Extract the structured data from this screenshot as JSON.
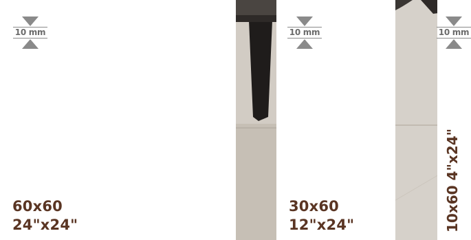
{
  "thickness_label": "10 mm",
  "formats": [
    {
      "metric": "60x60",
      "imperial": "24\"x24\""
    },
    {
      "metric": "30x60",
      "imperial": "12\"x24\""
    },
    {
      "metric": "10x60",
      "imperial": "4\"x24\""
    }
  ]
}
